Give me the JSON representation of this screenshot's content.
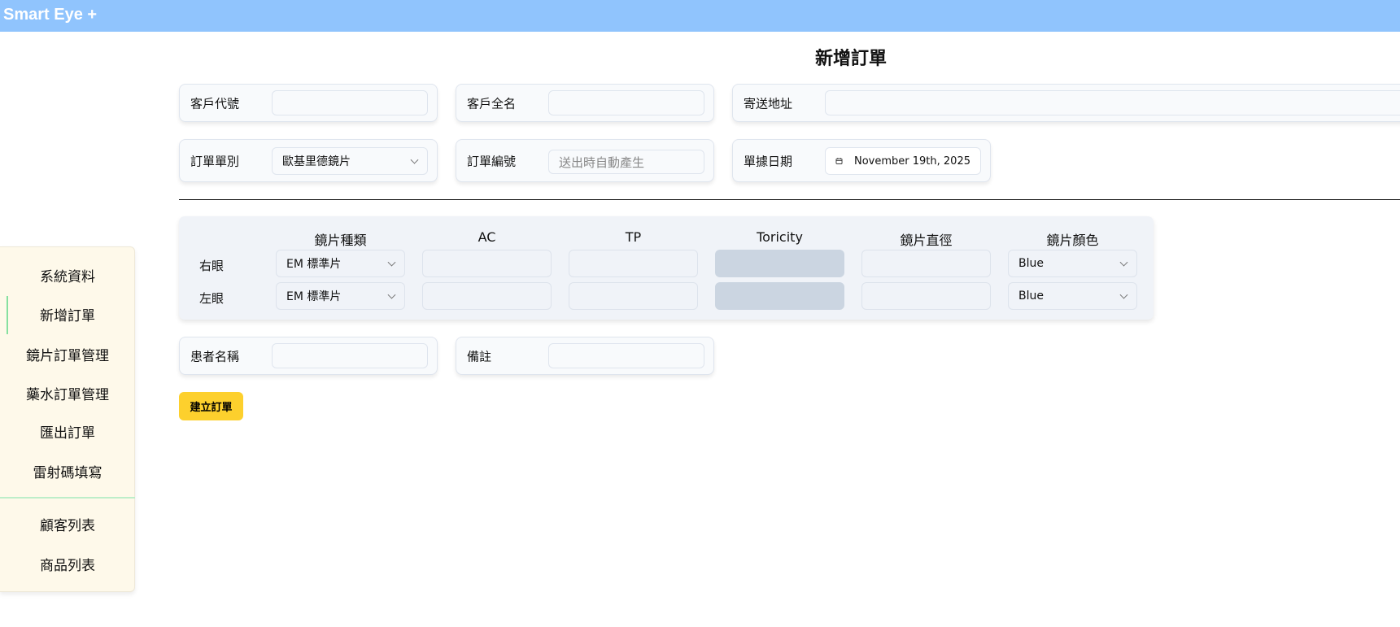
{
  "app": {
    "title": "Smart Eye +"
  },
  "page": {
    "title": "新增訂單"
  },
  "form": {
    "customer_code": {
      "label": "客戶代號",
      "value": ""
    },
    "customer_name": {
      "label": "客戶全名",
      "value": ""
    },
    "address": {
      "label": "寄送地址",
      "value": ""
    },
    "order_type": {
      "label": "訂單單別",
      "value": "歐基里德鏡片"
    },
    "order_number": {
      "label": "訂單編號",
      "placeholder": "送出時自動產生"
    },
    "doc_date": {
      "label": "單據日期",
      "value": "November 19th, 2025"
    },
    "patient_name": {
      "label": "患者名稱",
      "value": ""
    },
    "note": {
      "label": "備註",
      "value": ""
    }
  },
  "lens": {
    "columns": [
      "鏡片種類",
      "AC",
      "TP",
      "Toricity",
      "鏡片直徑",
      "鏡片顏色"
    ],
    "rows": [
      {
        "label": "右眼",
        "type": "EM 標準片",
        "ac": "",
        "tp": "",
        "toricity": "",
        "diameter": "",
        "color": "Blue"
      },
      {
        "label": "左眼",
        "type": "EM 標準片",
        "ac": "",
        "tp": "",
        "toricity": "",
        "diameter": "",
        "color": "Blue"
      }
    ]
  },
  "submit_label": "建立訂單",
  "sidebar": {
    "items": [
      "系統資料",
      "新增訂單",
      "鏡片訂單管理",
      "藥水訂單管理",
      "匯出訂單",
      "雷射碼填寫",
      "顧客列表",
      "商品列表"
    ],
    "active": "新增訂單"
  },
  "colors": {
    "header": "#90c4fd",
    "button": "#fdd02d",
    "sidebar": "#fef9ea",
    "accent": "#86e0a0"
  }
}
